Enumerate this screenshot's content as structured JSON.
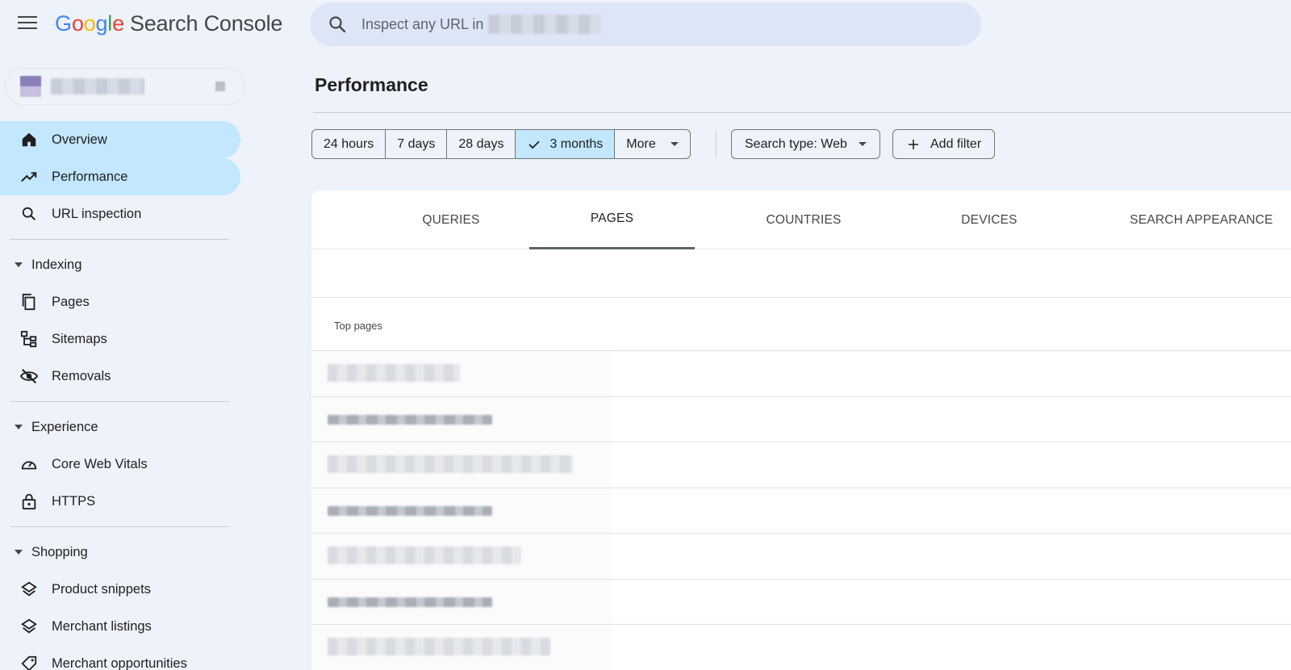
{
  "header": {
    "logo_letters": [
      "G",
      "o",
      "o",
      "g",
      "l",
      "e"
    ],
    "product_name": "Search Console",
    "search_placeholder": "Inspect any URL in"
  },
  "sidebar": {
    "nav": [
      {
        "label": "Overview",
        "icon": "home-icon",
        "active": true
      },
      {
        "label": "Performance",
        "icon": "trending-up-icon",
        "active": true
      },
      {
        "label": "URL inspection",
        "icon": "search-icon",
        "active": false
      }
    ],
    "sections": [
      {
        "title": "Indexing",
        "items": [
          {
            "label": "Pages",
            "icon": "pages-icon"
          },
          {
            "label": "Sitemaps",
            "icon": "sitemap-icon"
          },
          {
            "label": "Removals",
            "icon": "eye-off-icon"
          }
        ]
      },
      {
        "title": "Experience",
        "items": [
          {
            "label": "Core Web Vitals",
            "icon": "speedometer-icon"
          },
          {
            "label": "HTTPS",
            "icon": "lock-icon"
          }
        ]
      },
      {
        "title": "Shopping",
        "items": [
          {
            "label": "Product snippets",
            "icon": "layers-icon"
          },
          {
            "label": "Merchant listings",
            "icon": "layers-icon"
          },
          {
            "label": "Merchant opportunities",
            "icon": "tag-icon"
          }
        ]
      }
    ]
  },
  "main": {
    "title": "Performance",
    "date_ranges": [
      {
        "label": "24 hours",
        "selected": false
      },
      {
        "label": "7 days",
        "selected": false
      },
      {
        "label": "28 days",
        "selected": false
      },
      {
        "label": "3 months",
        "selected": true
      },
      {
        "label": "More",
        "selected": false,
        "dropdown": true
      }
    ],
    "search_type_label": "Search type: Web",
    "add_filter_label": "Add filter",
    "tabs": [
      {
        "label": "QUERIES",
        "active": false
      },
      {
        "label": "PAGES",
        "active": true
      },
      {
        "label": "COUNTRIES",
        "active": false
      },
      {
        "label": "DEVICES",
        "active": false
      },
      {
        "label": "SEARCH APPEARANCE",
        "active": false
      }
    ],
    "table_label": "Top pages"
  },
  "colors": {
    "background": "#eef2fa",
    "active_nav": "#c2e7ff",
    "search_bar": "#dde6f6",
    "card": "#ffffff"
  }
}
